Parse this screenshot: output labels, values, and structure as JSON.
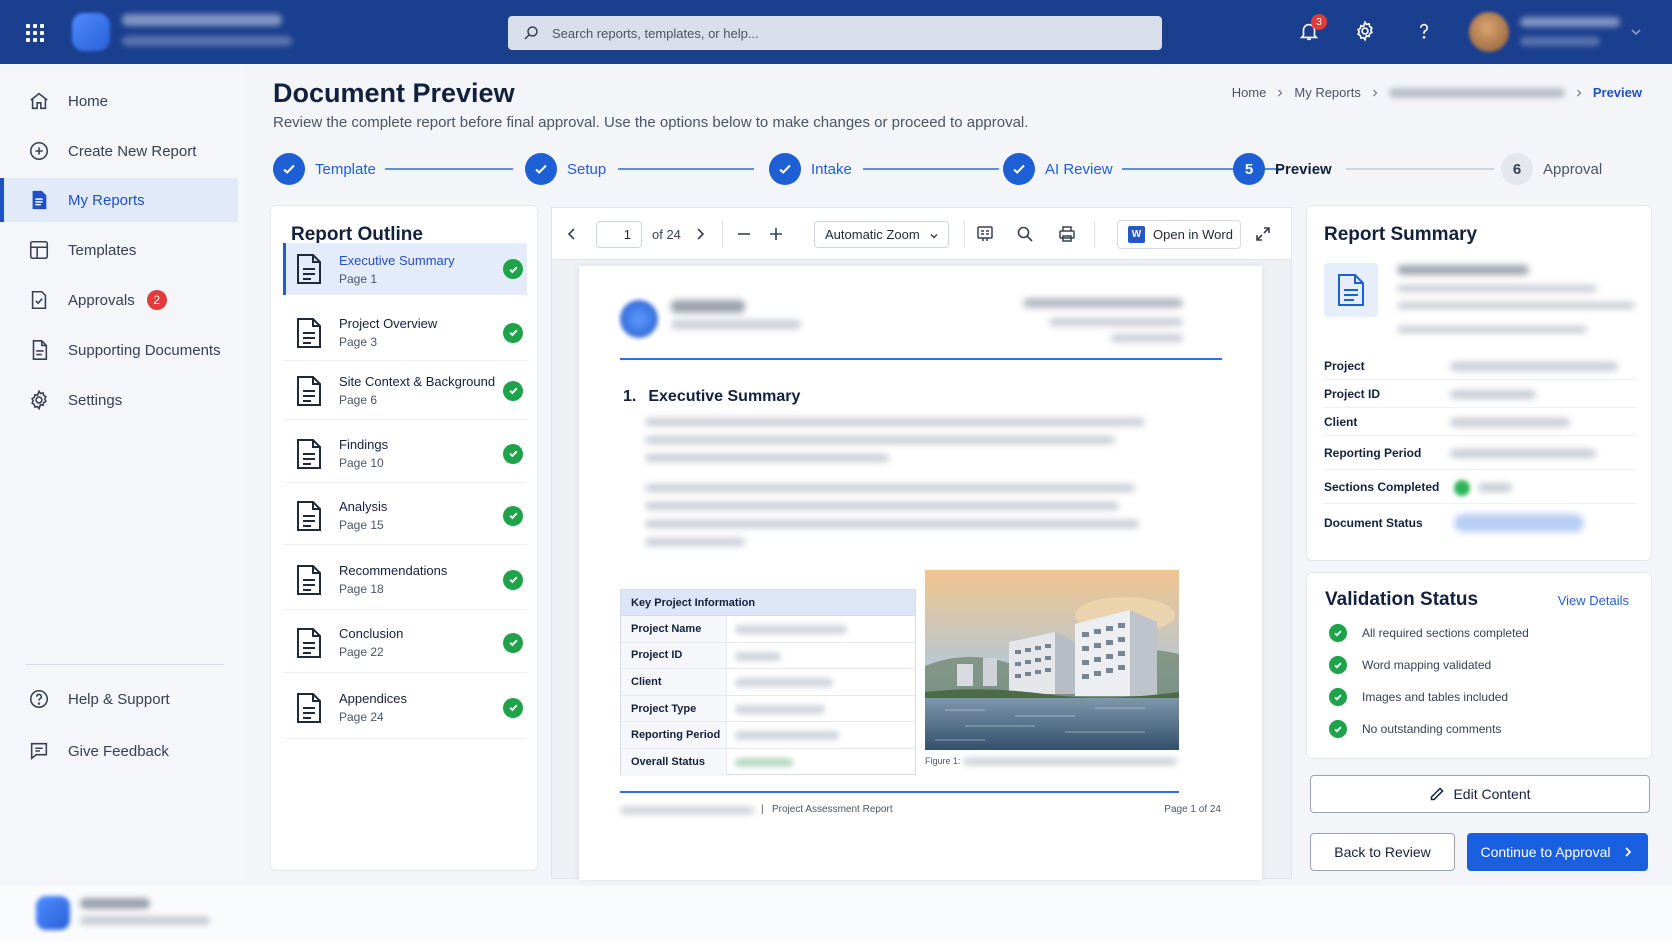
{
  "topbar": {
    "search_placeholder": "Search reports, templates, or help...",
    "notification_count": "3"
  },
  "sidebar": {
    "items": [
      {
        "label": "Home",
        "icon": "home-icon"
      },
      {
        "label": "Create New Report",
        "icon": "plus-circle-icon"
      },
      {
        "label": "My Reports",
        "icon": "document-icon",
        "active": true
      },
      {
        "label": "Templates",
        "icon": "layout-icon"
      },
      {
        "label": "Approvals",
        "icon": "check-square-icon",
        "badge": "2"
      },
      {
        "label": "Supporting Documents",
        "icon": "file-icon"
      },
      {
        "label": "Settings",
        "icon": "gear-icon"
      }
    ],
    "bottom_items": [
      {
        "label": "Help & Support",
        "icon": "question-circle-icon"
      },
      {
        "label": "Give Feedback",
        "icon": "feedback-icon"
      }
    ]
  },
  "header": {
    "title": "Document Preview",
    "subtitle": "Review the complete report before final approval. Use the options below to make changes or proceed to approval.",
    "breadcrumb": {
      "home": "Home",
      "my_reports": "My Reports",
      "current": "Preview"
    }
  },
  "stepper": {
    "steps": [
      {
        "label": "Template",
        "state": "done"
      },
      {
        "label": "Setup",
        "state": "done"
      },
      {
        "label": "Intake",
        "state": "done"
      },
      {
        "label": "AI Review",
        "state": "done"
      },
      {
        "label": "Preview",
        "number": "5",
        "state": "current"
      },
      {
        "label": "Approval",
        "number": "6",
        "state": "pending"
      }
    ]
  },
  "outline": {
    "title": "Report Outline",
    "items": [
      {
        "name": "Executive Summary",
        "page": "Page 1"
      },
      {
        "name": "Project Overview",
        "page": "Page 3"
      },
      {
        "name": "Site Context & Background",
        "page": "Page 6"
      },
      {
        "name": "Findings",
        "page": "Page 10"
      },
      {
        "name": "Analysis",
        "page": "Page 15"
      },
      {
        "name": "Recommendations",
        "page": "Page 18"
      },
      {
        "name": "Conclusion",
        "page": "Page 22"
      },
      {
        "name": "Appendices",
        "page": "Page 24"
      }
    ]
  },
  "viewer": {
    "current_page": "1",
    "total_label": "of 24",
    "zoom": "Automatic Zoom",
    "open_word_label": "Open in Word",
    "word_icon_letter": "W",
    "document": {
      "section_number": "1.",
      "section_title": "Executive Summary",
      "table_header": "Key Project Information",
      "table_rows": [
        "Project Name",
        "Project ID",
        "Client",
        "Project Type",
        "Reporting Period",
        "Overall Status"
      ],
      "figure_caption": "Figure 1:",
      "footer_title": "Project Assessment Report",
      "footer_separator": "|",
      "page_label": "Page 1 of 24"
    }
  },
  "summary": {
    "title": "Report Summary",
    "rows": [
      "Project",
      "Project ID",
      "Client",
      "Reporting Period",
      "Sections Completed",
      "Document Status"
    ]
  },
  "validation": {
    "title": "Validation Status",
    "link": "View Details",
    "items": [
      "All required sections completed",
      "Word mapping validated",
      "Images and tables included",
      "No outstanding comments"
    ]
  },
  "actions": {
    "edit": "Edit Content",
    "back": "Back to Review",
    "continue": "Continue to Approval"
  },
  "colors": {
    "topbar": "#1b3f8f",
    "accent": "#1f5fd6",
    "success": "#1ea34b",
    "badge": "#e23b3b"
  }
}
